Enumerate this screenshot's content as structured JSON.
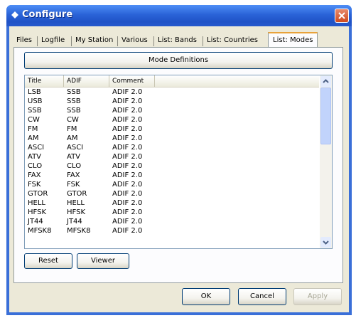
{
  "window": {
    "title": "Configure"
  },
  "tabs": [
    "Files",
    "Logfile",
    "My Station",
    "Various",
    "List: Bands",
    "List: Countries",
    "List: Modes"
  ],
  "active_tab": "List: Modes",
  "mode_definitions_label": "Mode Definitions",
  "list": {
    "columns": [
      "Title",
      "ADIF",
      "Comment"
    ],
    "rows": [
      [
        "LSB",
        "SSB",
        "ADIF 2.0"
      ],
      [
        "USB",
        "SSB",
        "ADIF 2.0"
      ],
      [
        "SSB",
        "SSB",
        "ADIF 2.0"
      ],
      [
        "CW",
        "CW",
        "ADIF 2.0"
      ],
      [
        "FM",
        "FM",
        "ADIF 2.0"
      ],
      [
        "AM",
        "AM",
        "ADIF 2.0"
      ],
      [
        "ASCI",
        "ASCI",
        "ADIF 2.0"
      ],
      [
        "ATV",
        "ATV",
        "ADIF 2.0"
      ],
      [
        "CLO",
        "CLO",
        "ADIF 2.0"
      ],
      [
        "FAX",
        "FAX",
        "ADIF 2.0"
      ],
      [
        "FSK",
        "FSK",
        "ADIF 2.0"
      ],
      [
        "GTOR",
        "GTOR",
        "ADIF 2.0"
      ],
      [
        "HELL",
        "HELL",
        "ADIF 2.0"
      ],
      [
        "HFSK",
        "HFSK",
        "ADIF 2.0"
      ],
      [
        "JT44",
        "JT44",
        "ADIF 2.0"
      ],
      [
        "MFSK8",
        "MFSK8",
        "ADIF 2.0"
      ]
    ]
  },
  "buttons": {
    "reset": "Reset",
    "viewer": "Viewer",
    "ok": "OK",
    "cancel": "Cancel",
    "apply": "Apply"
  },
  "icons": {
    "title": "diamond-icon",
    "close": "close-icon",
    "scroll_up": "scroll-up-arrow-icon",
    "scroll_down": "scroll-down-arrow-icon"
  },
  "colors": {
    "titlebar": "#2a63d8",
    "close": "#d04a1e",
    "active_tab_accent": "#e8a23a",
    "face": "#ece9d8"
  }
}
